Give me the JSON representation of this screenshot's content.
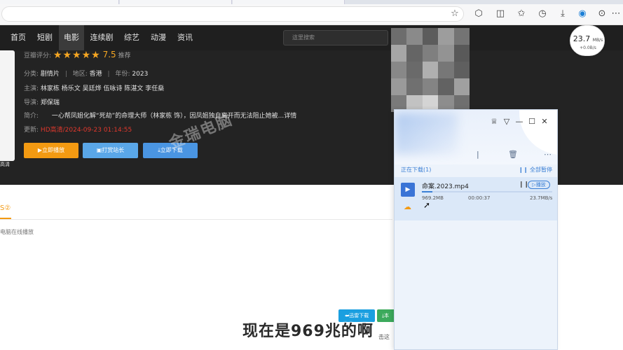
{
  "browser": {
    "icons": [
      "star-icon",
      "extension-icon",
      "split-screen-icon",
      "favorites-icon",
      "history-icon",
      "downloads-icon",
      "edge-icon",
      "profile-icon",
      "more-icon"
    ]
  },
  "nav": {
    "items": [
      "首页",
      "短剧",
      "电影",
      "连续剧",
      "综艺",
      "动漫",
      "资讯"
    ],
    "active": "电影",
    "search_placeholder": "這里搜索"
  },
  "movie": {
    "rating_label": "豆瓣评分:",
    "rating_score": "7.5",
    "rating_suffix": "推荐",
    "category_label": "分类:",
    "category": "剧情片",
    "region_label": "地区:",
    "region": "香港",
    "year_label": "年份:",
    "year": "2023",
    "cast_label": "主演:",
    "cast": "林家栋 杨乐文 吴廷烨 伍咏诗 陈湛文 李任燊",
    "director_label": "导演:",
    "director": "郑保瑞",
    "synopsis_label": "简介:",
    "synopsis": "一心帮凤姐化解“死劫”的命理大师（林家栋 饰），因凤姐独自离开而无法阻止她被...详情",
    "update_label": "更新:",
    "update": "HD高清/2024-09-23 01:14:55",
    "poster_tag": "高清",
    "buttons": {
      "play": "▶立即播放",
      "station": "▣打赏站长",
      "download": "⤓立即下载"
    }
  },
  "lower": {
    "tab": "S②",
    "note": "电脑在线播放",
    "xunlei_btn": "⮨迅雷下载",
    "local_btn": "⤓本",
    "behind_text": "击这"
  },
  "watermark": "金瑞电脑",
  "speed_widget": {
    "value": "23.7",
    "unit": "MB/s",
    "sub": "+0.0B/s"
  },
  "download_panel": {
    "status": "正在下载(1)",
    "pause_all": "全部暂停",
    "file": {
      "name": "命案.2023.mp4",
      "size": "969.2MB",
      "elapsed": "00:00:37",
      "speed": "23.7MB/s",
      "play_label": "播放",
      "progress": 0.08
    }
  },
  "subtitle": "现在是969兆的啊",
  "colors": {
    "accent_orange": "#f39a12",
    "accent_blue": "#3a7fd5",
    "update_red": "#e0382d"
  }
}
